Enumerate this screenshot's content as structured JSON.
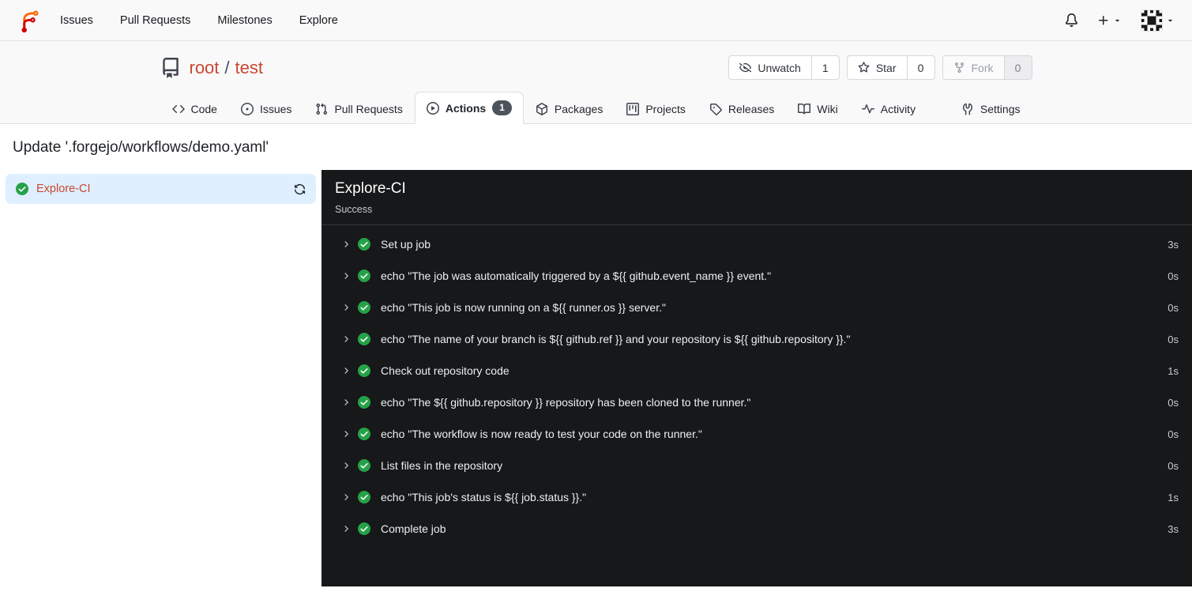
{
  "colors": {
    "accent": "#c9472f",
    "green": "#26a148",
    "panel_bg": "#17181a",
    "selected_bg": "#dfefff",
    "badge_bg": "#4c535b",
    "navbar_bg": "#f9f9fa",
    "border_light": "#e5e6e8",
    "border_tabs": "#dcdee2"
  },
  "navbar": {
    "items": [
      "Issues",
      "Pull Requests",
      "Milestones",
      "Explore"
    ]
  },
  "repo_header": {
    "owner": "root",
    "separator": "/",
    "name": "test",
    "buttons": {
      "unwatch": {
        "label": "Unwatch",
        "count": "1"
      },
      "star": {
        "label": "Star",
        "count": "0"
      },
      "fork": {
        "label": "Fork",
        "count": "0"
      }
    }
  },
  "tabs": [
    {
      "label": "Code"
    },
    {
      "label": "Issues"
    },
    {
      "label": "Pull Requests"
    },
    {
      "label": "Actions",
      "badge": "1"
    },
    {
      "label": "Packages"
    },
    {
      "label": "Projects"
    },
    {
      "label": "Releases"
    },
    {
      "label": "Wiki"
    },
    {
      "label": "Activity"
    },
    {
      "label": "Settings"
    }
  ],
  "page_title": "Update '.forgejo/workflows/demo.yaml'",
  "jobs_sidebar": {
    "jobs": [
      {
        "name": "Explore-CI",
        "status": "success",
        "selected": true
      }
    ]
  },
  "job_panel": {
    "title": "Explore-CI",
    "status": "Success",
    "steps": [
      {
        "name": "Set up job",
        "duration": "3s"
      },
      {
        "name": "echo \"The job was automatically triggered by a ${{ github.event_name }} event.\"",
        "duration": "0s"
      },
      {
        "name": "echo \"This job is now running on a ${{ runner.os }} server.\"",
        "duration": "0s"
      },
      {
        "name": "echo \"The name of your branch is ${{ github.ref }} and your repository is ${{ github.repository }}.\"",
        "duration": "0s"
      },
      {
        "name": "Check out repository code",
        "duration": "1s"
      },
      {
        "name": "echo \"The ${{ github.repository }} repository has been cloned to the runner.\"",
        "duration": "0s"
      },
      {
        "name": "echo \"The workflow is now ready to test your code on the runner.\"",
        "duration": "0s"
      },
      {
        "name": "List files in the repository",
        "duration": "0s"
      },
      {
        "name": "echo \"This job's status is ${{ job.status }}.\"",
        "duration": "1s"
      },
      {
        "name": "Complete job",
        "duration": "3s"
      }
    ]
  }
}
